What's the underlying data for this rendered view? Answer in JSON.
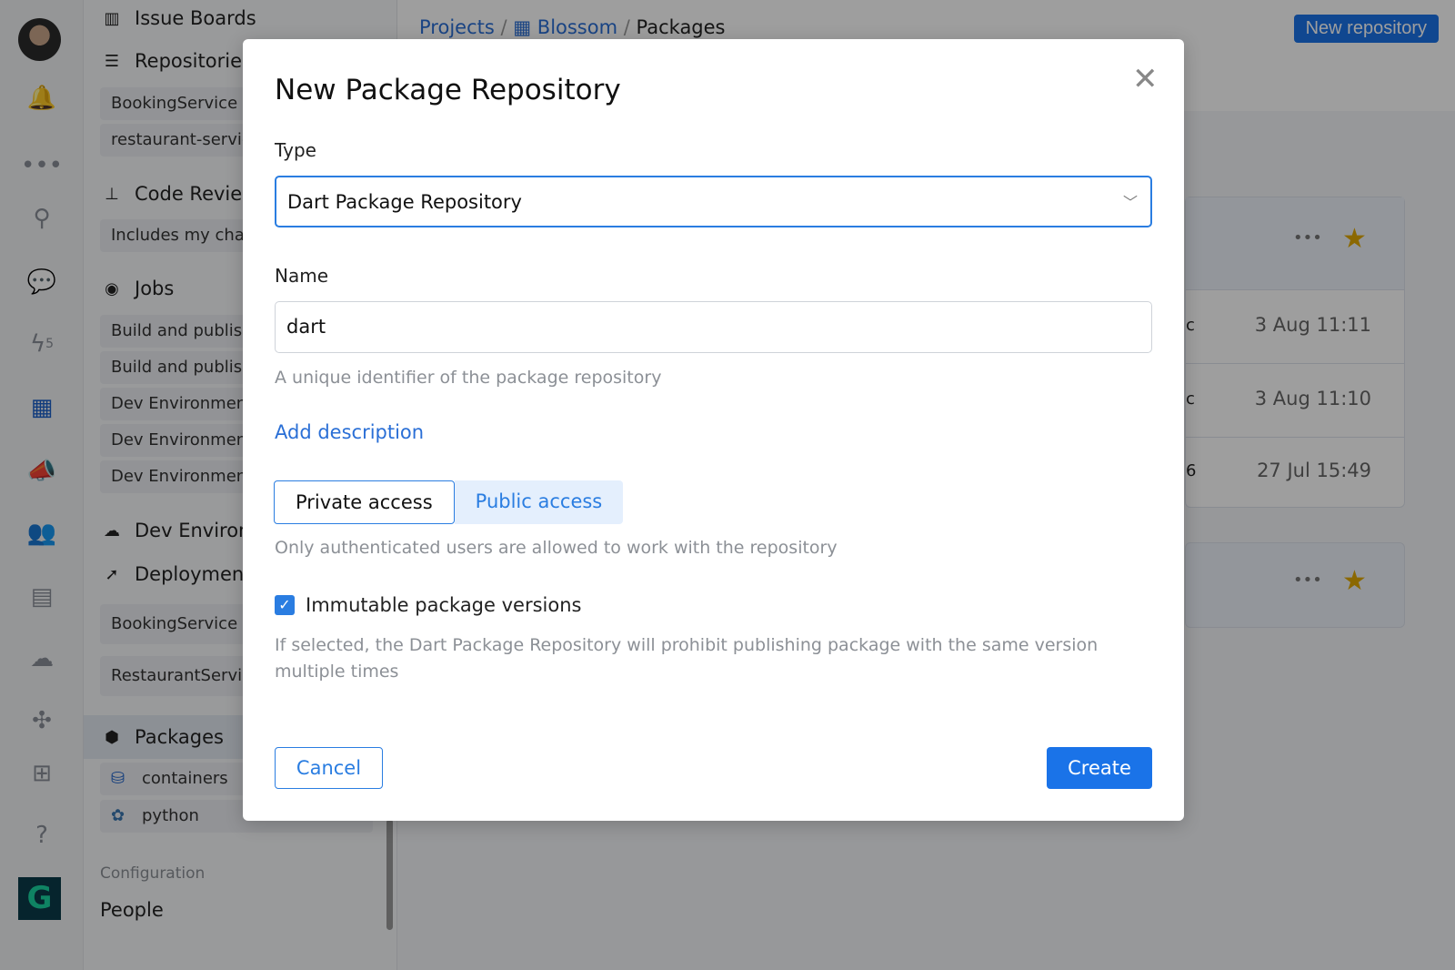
{
  "rail": {
    "badge": "5",
    "icons": [
      "avatar",
      "bell-icon",
      "more-icon",
      "search-icon",
      "chat-icon",
      "lightning-icon",
      "apps-icon",
      "megaphone-icon",
      "team-icon",
      "calendar-icon",
      "cloud-icon",
      "puzzle-icon",
      "plus-icon",
      "help-icon",
      "logo"
    ]
  },
  "sidebar": {
    "issue_boards": "Issue Boards",
    "repositories": "Repositories",
    "repo_items": [
      "BookingService",
      "restaurant-service"
    ],
    "code_reviews": "Code Reviews",
    "cr_items": [
      "Includes my changes"
    ],
    "jobs": "Jobs",
    "job_items": [
      "Build and publish",
      "Build and publish",
      "Dev Environment",
      "Dev Environment",
      "Dev Environment"
    ],
    "dev_env": "Dev Environments",
    "deployments": "Deployments",
    "deploy_items": [
      "BookingService",
      "RestaurantService"
    ],
    "packages": "Packages",
    "package_items": [
      "containers",
      "python"
    ],
    "config_label": "Configuration",
    "people": "People"
  },
  "header": {
    "crumbs": [
      "Projects",
      "Blossom",
      "Packages"
    ],
    "new_repository": "New repository"
  },
  "list": {
    "rows": [
      {
        "suffix": "c",
        "date": "3 Aug 11:11"
      },
      {
        "suffix": "c",
        "date": "3 Aug 11:10"
      },
      {
        "suffix": "6",
        "date": "27 Jul 15:49"
      }
    ],
    "star_color": "#e0a800"
  },
  "modal": {
    "title": "New Package Repository",
    "type_label": "Type",
    "type_value": "Dart Package Repository",
    "name_label": "Name",
    "name_value": "dart",
    "name_hint": "A unique identifier of the package repository",
    "add_description": "Add description",
    "private": "Private access",
    "public": "Public access",
    "access_hint": "Only authenticated users are allowed to work with the repository",
    "immutable_label": "Immutable package versions",
    "immutable_checked": true,
    "immutable_hint": "If selected, the Dart Package Repository will prohibit publishing package with the same version multiple times",
    "cancel": "Cancel",
    "create": "Create"
  },
  "colors": {
    "accent": "#1a73e8"
  }
}
